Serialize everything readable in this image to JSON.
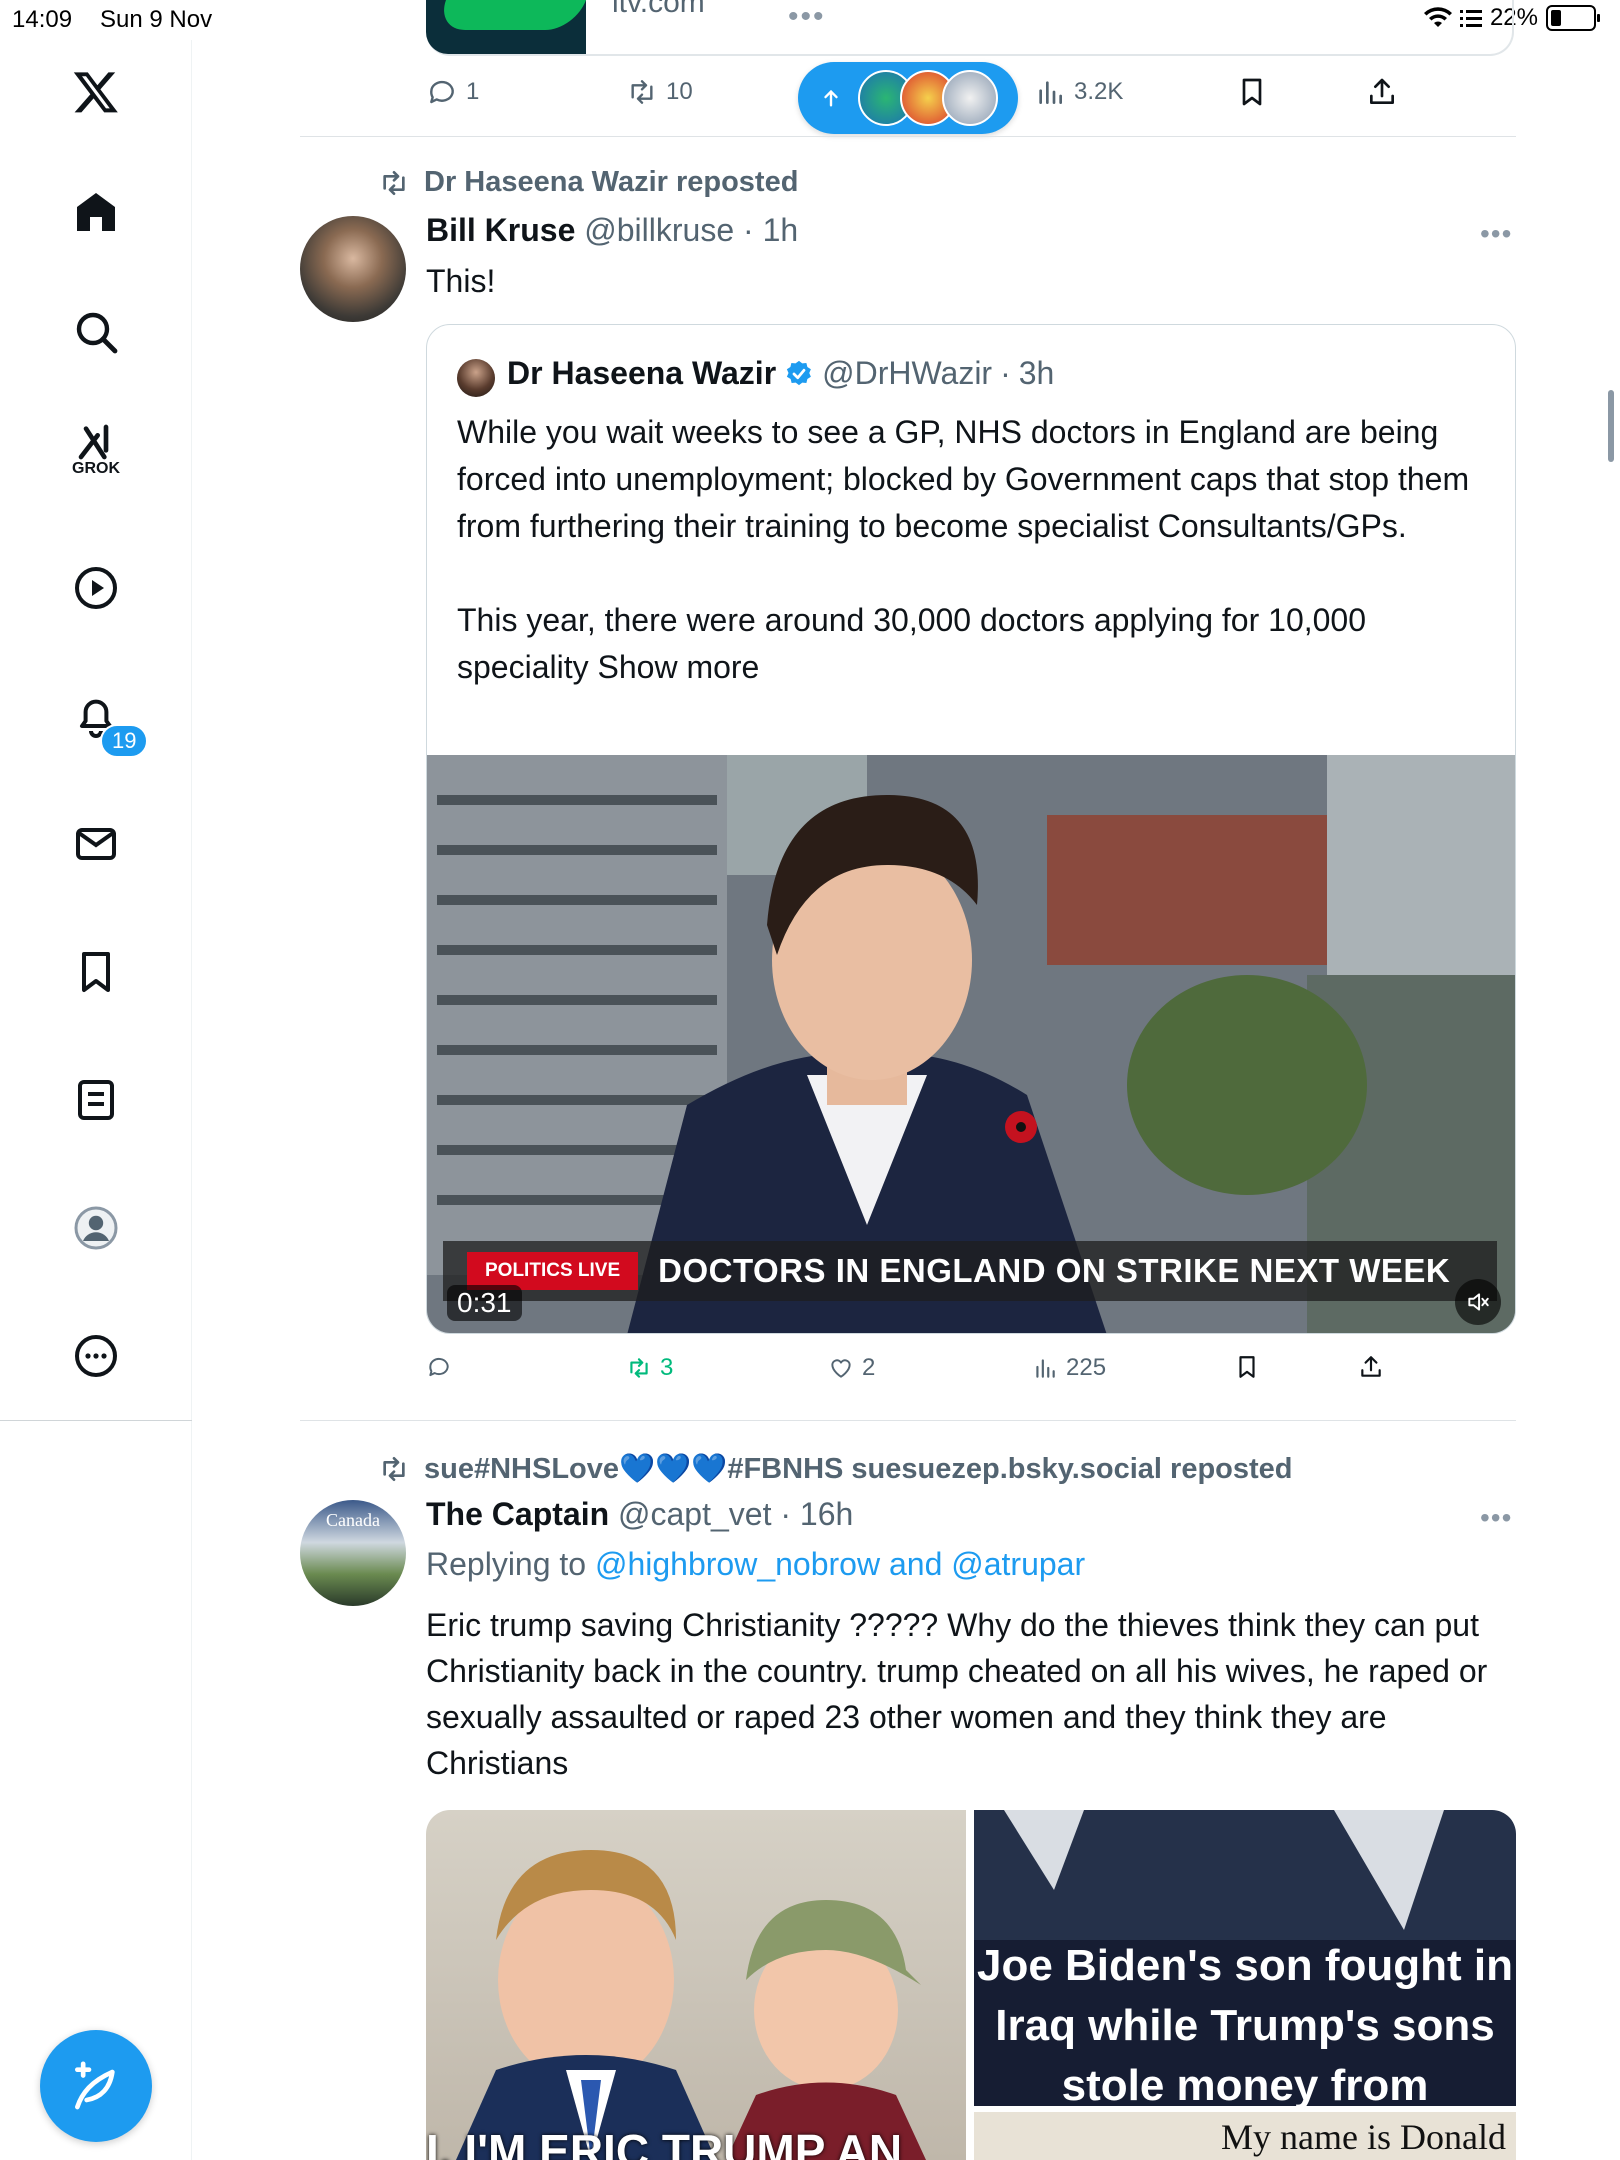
{
  "status_bar": {
    "time": "14:09",
    "date": "Sun 9 Nov",
    "battery": "22%"
  },
  "sidebar": {
    "notifications_badge": "19",
    "grok_label": "GROK"
  },
  "previous_post": {
    "link_host": "itv.com",
    "replies": "1",
    "reposts": "10",
    "views": "3.2K"
  },
  "post1": {
    "repost_by": "Dr Haseena Wazir reposted",
    "name": "Bill Kruse",
    "handle": "@billkruse",
    "time": "1h",
    "text": "This!",
    "quote": {
      "name": "Dr Haseena Wazir",
      "handle": "@DrHWazir",
      "time": "3h",
      "para1": "While you wait weeks to see a GP, NHS doctors in England are being forced into unemployment; blocked by Government caps that stop them from furthering their training to become specialist Consultants/GPs.",
      "para2": "This year, there were around 30,000 doctors applying for 10,000 speciality",
      "show_more": "Show more",
      "video": {
        "tag": "POLITICS LIVE",
        "headline": "DOCTORS IN ENGLAND ON STRIKE NEXT WEEK",
        "duration": "0:31"
      }
    },
    "reposts": "3",
    "likes": "2",
    "views": "225"
  },
  "post2": {
    "repost_by": "sue#NHSLove💙💙💙#FBNHS suesuezep.bsky.social reposted",
    "name": "The Captain",
    "handle": "@capt_vet",
    "time": "16h",
    "replying_prefix": "Replying to",
    "replying_to": "@highbrow_nobrow and @atrupar",
    "text": "Eric trump saving Christianity ????? Why do the thieves think they can put Christianity back in the country. trump cheated on all his wives, he raped or sexually assaulted or raped 23 other women and they think they are Christians",
    "image_right_caption": "Joe Biden's son fought in Iraq while Trump's sons stole money from",
    "image_left_caption": "I, I'M ERIC TRUMP AN",
    "image_bottom_caption": "My name is Donald",
    "avatar_text": "Canada"
  },
  "colors": {
    "accent": "#1d9bf0",
    "retweet_green": "#00ba7c",
    "muted": "#536471"
  }
}
